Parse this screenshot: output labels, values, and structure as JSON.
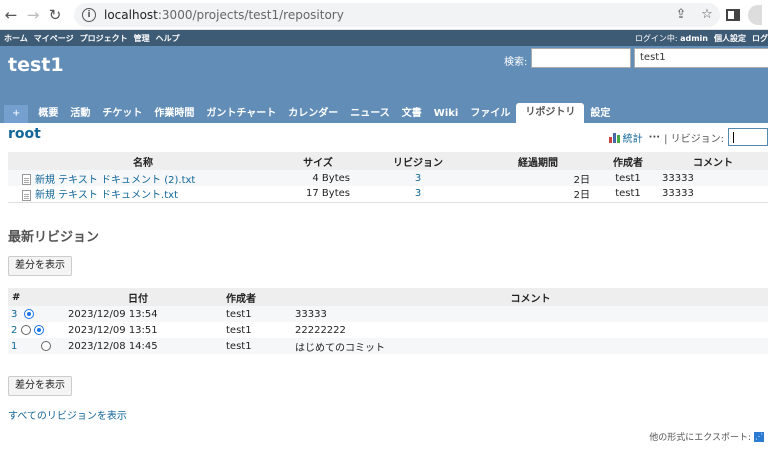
{
  "browser": {
    "url_host": "localhost",
    "url_rest": ":3000/projects/test1/repository"
  },
  "top_menu": {
    "items": [
      "ホーム",
      "マイページ",
      "プロジェクト",
      "管理",
      "ヘルプ"
    ],
    "logged_in_label": "ログイン中:",
    "user": "admin",
    "personal_settings": "個人設定",
    "logout": "ログ"
  },
  "header": {
    "title": "test1",
    "search_label": "検索:",
    "project_jump": "test1"
  },
  "tabs": [
    "+",
    "概要",
    "活動",
    "チケット",
    "作業時間",
    "ガントチャート",
    "カレンダー",
    "ニュース",
    "文書",
    "Wiki",
    "ファイル",
    "リポジトリ",
    "設定"
  ],
  "selected_tab": "リポジトリ",
  "repository": {
    "title": "root",
    "stats_label": "統計",
    "revision_label": "| リビジョン:",
    "columns": [
      "名称",
      "サイズ",
      "リビジョン",
      "経過期間",
      "作成者",
      "コメント"
    ],
    "files": [
      {
        "name": "新規 テキスト ドキュメント (2).txt",
        "size": "4 Bytes",
        "revision": "3",
        "age": "2日",
        "author": "test1",
        "comment": "33333"
      },
      {
        "name": "新規 テキスト ドキュメント.txt",
        "size": "17 Bytes",
        "revision": "3",
        "age": "2日",
        "author": "test1",
        "comment": "33333"
      }
    ]
  },
  "latest_revisions": {
    "title": "最新リビジョン",
    "diff_button": "差分を表示",
    "columns": [
      "#",
      "日付",
      "作成者",
      "コメント"
    ],
    "rows": [
      {
        "id": "3",
        "date": "2023/12/09 13:54",
        "author": "test1",
        "comment": "33333"
      },
      {
        "id": "2",
        "date": "2023/12/09 13:51",
        "author": "test1",
        "comment": "22222222"
      },
      {
        "id": "1",
        "date": "2023/12/08 14:45",
        "author": "test1",
        "comment": "はじめてのコミット"
      }
    ],
    "show_all": "すべてのリビジョンを表示"
  },
  "footer": {
    "export_label": "他の形式にエクスポート:"
  },
  "colors": {
    "header_bg": "#628db6",
    "top_menu_bg": "#3e5b76",
    "link": "#116699",
    "selected_radio": "#1a73e8"
  }
}
